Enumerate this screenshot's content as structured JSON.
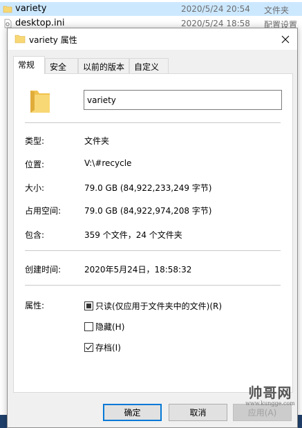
{
  "explorer": {
    "rows": [
      {
        "name": "variety",
        "date": "2020/5/24 20:54",
        "type": "文件夹",
        "icon": "folder-icon"
      },
      {
        "name": "desktop.ini",
        "date": "2020/5/24 18:58",
        "type": "配置设置",
        "icon": "settings-file-icon"
      }
    ]
  },
  "dialog": {
    "title": "variety 属性",
    "tabs": [
      "常规",
      "安全",
      "以前的版本",
      "自定义"
    ],
    "active_tab": "常规",
    "name_value": "variety",
    "properties": [
      {
        "label": "类型:",
        "value": "文件夹"
      },
      {
        "label": "位置:",
        "value": "V:\\#recycle"
      },
      {
        "label": "大小:",
        "value": "79.0 GB (84,922,233,249 字节)"
      },
      {
        "label": "占用空间:",
        "value": "79.0 GB (84,922,974,208 字节)"
      },
      {
        "label": "包含:",
        "value": "359 个文件，24 个文件夹"
      }
    ],
    "created": {
      "label": "创建时间:",
      "value": "2020年5月24日，18:58:32"
    },
    "attributes": {
      "label": "属性:",
      "readonly": {
        "label": "只读(仅应用于文件夹中的文件)(R)",
        "state": "indeterminate"
      },
      "hidden": {
        "label": "隐藏(H)",
        "state": "unchecked"
      },
      "archive": {
        "label": "存档(I)",
        "state": "checked"
      }
    },
    "buttons": {
      "ok": "确定",
      "cancel": "取消",
      "apply": "应用(A)"
    }
  },
  "watermark": {
    "main": "帅哥网",
    "sub": "www.kungge.com"
  },
  "colors": {
    "selection": "#cce8ff",
    "accent": "#0078d7",
    "folder": "#f8d775"
  }
}
